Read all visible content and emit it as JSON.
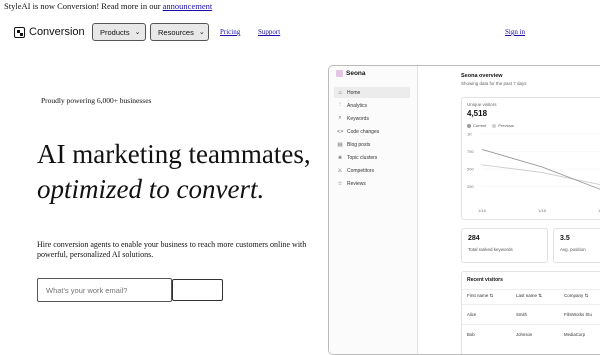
{
  "banner": {
    "text": "StyleAI is now Conversion! Read more in our ",
    "link": "announcement"
  },
  "nav": {
    "brand": "Conversion",
    "products": "Products",
    "resources": "Resources",
    "pricing": "Pricing",
    "support": "Support",
    "signin": "Sign in"
  },
  "hero": {
    "tagline": "Proudly powering 6,000+ businesses",
    "headline_1": "AI marketing teammates,",
    "headline_2": "optimized to convert.",
    "subtitle": "Hire conversion agents to enable your business to reach more customers online with powerful, personalized AI solutions.",
    "email_placeholder": "What's your work email?"
  },
  "app": {
    "brand": "Seona",
    "sidebar": [
      {
        "label": "Home",
        "icon": "home-icon",
        "glyph": "⌂"
      },
      {
        "label": "Analytics",
        "icon": "analytics-icon",
        "glyph": "⫶"
      },
      {
        "label": "Keywords",
        "icon": "keywords-icon",
        "glyph": "⌕"
      },
      {
        "label": "Code changes",
        "icon": "code-icon",
        "glyph": "<>"
      },
      {
        "label": "Blog posts",
        "icon": "blog-icon",
        "glyph": "▤"
      },
      {
        "label": "Topic clusters",
        "icon": "topic-icon",
        "glyph": "⋇"
      },
      {
        "label": "Competitors",
        "icon": "competitors-icon",
        "glyph": "⚔"
      },
      {
        "label": "Reviews",
        "icon": "reviews-icon",
        "glyph": "☆"
      }
    ],
    "overview_title": "Seona overview",
    "overview_sub": "Showing data for the past 7 days",
    "unique_visitors_label": "Unique visitors",
    "unique_visitors_value": "4,518",
    "legend_current": "Current",
    "legend_previous": "Previous",
    "stat_keywords_value": "284",
    "stat_keywords_label": "Total ranked keywords",
    "stat_position_value": "3.5",
    "stat_position_label": "Avg. position",
    "recent_title": "Recent visitors",
    "table_headers": [
      "First name",
      "Last name",
      "Company"
    ],
    "table_rows": [
      [
        "Alice",
        "Smith",
        "FilmWorks Stu"
      ],
      [
        "Bob",
        "Johnson",
        "MediaCorp"
      ]
    ]
  },
  "chart_data": {
    "type": "line",
    "x": [
      "1/16",
      "1/18",
      "1/20"
    ],
    "series": [
      {
        "name": "Current",
        "values": [
          780,
          530,
          200
        ]
      },
      {
        "name": "Previous",
        "values": [
          560,
          450,
          270
        ]
      }
    ],
    "ytick_labels": [
      "1K",
      "750",
      "500",
      "250"
    ],
    "ylim": [
      0,
      1000
    ],
    "colors": {
      "Current": "#9a9a9a",
      "Previous": "#cfcfcf"
    }
  }
}
